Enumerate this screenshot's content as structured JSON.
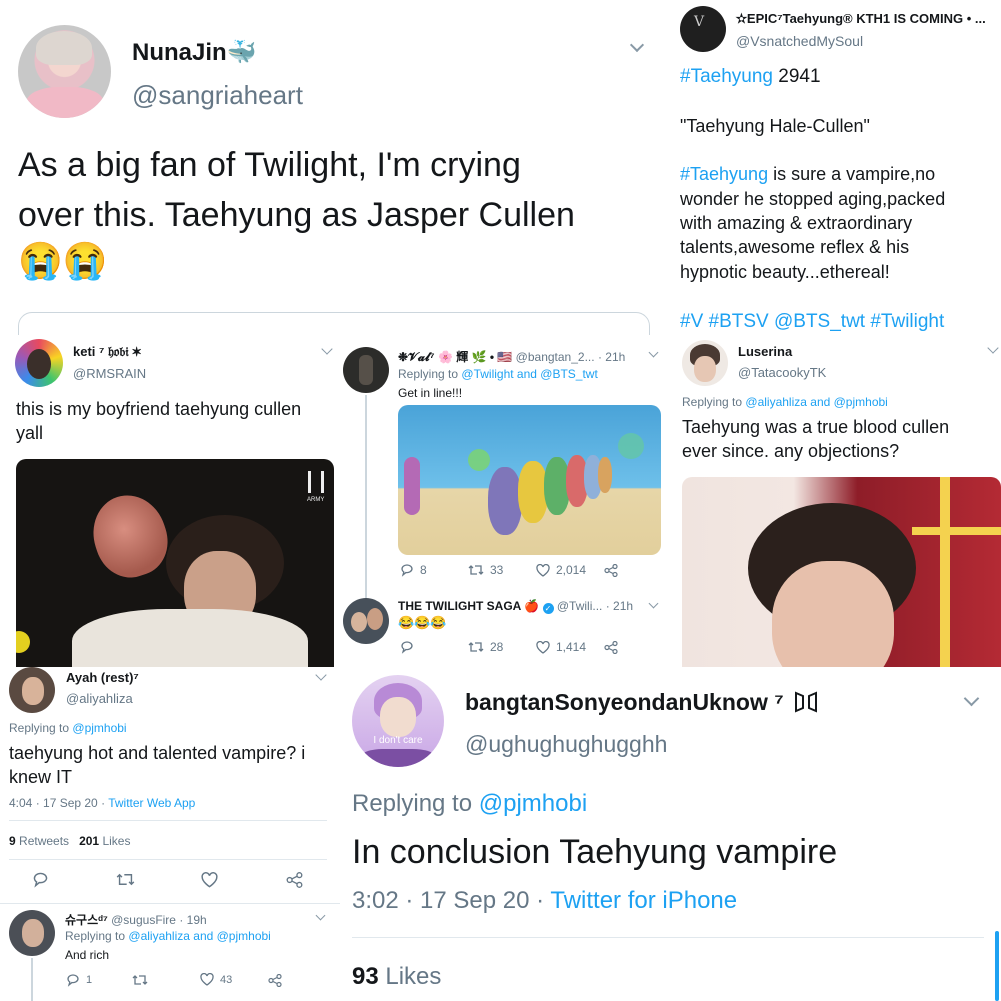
{
  "p1": {
    "name": "NunaJin",
    "emoji": "🐳",
    "handle": "@sangriaheart",
    "lines": [
      "As a big fan of Twilight, I'm crying",
      "over this. Taehyung as Jasper Cullen"
    ],
    "emojis": "😭😭"
  },
  "p2": {
    "name": "✫EPIC⁷Taehyung® KTH1 IS COMING • ...",
    "handle": "@VsnatchedMySoul",
    "line1_tag": "#Taehyung",
    "line1_rest": " 2941",
    "quote": "\"Taehyung Hale-Cullen\"",
    "body_tag": "#Taehyung",
    "body_lines": [
      " is sure a vampire,no",
      "wonder he stopped aging,packed",
      "with amazing & extraordinary",
      "talents,awesome reflex & his",
      "hypnotic beauty...ethereal!"
    ],
    "tags": "#V #BTSV @BTS_twt #Twilight"
  },
  "p3": {
    "name": "keti ⁷ 𝔥𝔬𝔟𝔦 ✶",
    "handle": "@RMSRAIN",
    "lines": [
      "this is my boyfriend taehyung cullen",
      "yall"
    ],
    "logo": "ARMY"
  },
  "p4": {
    "t1_name": "❉𝓥𝓪𝓵⁷ 🌸 輝 🌿 • 🇺🇸",
    "t1_handle": "@bangtan_2...",
    "t1_time": "· 21h",
    "t1_replying": "Replying to",
    "t1_mentions": "@Twilight and @BTS_twt",
    "t1_text": "Get in line!!!",
    "t1_retweets": "33",
    "t1_likes": "2,014",
    "t1_replies": "8",
    "t2_name": "THE TWILIGHT SAGA 🍎",
    "t2_handle": "@Twili...",
    "t2_time": "· 21h",
    "t2_text": "😂😂😂",
    "t2_retweets": "28",
    "t2_likes": "1,414"
  },
  "p5": {
    "name": "Luserina",
    "handle": "@TatacookyTK",
    "replying": "Replying to",
    "mentions": "@aliyahliza and @pjmhobi",
    "lines": [
      "Taehyung was a true blood cullen",
      "ever since. any objections?"
    ]
  },
  "p6": {
    "name": "Ayah (rest)⁷",
    "handle": "@aliyahliza",
    "replying": "Replying to",
    "mention": "@pjmhobi",
    "lines": [
      "taehyung hot and talented vampire? i",
      "knew IT"
    ],
    "time": "4:04 · 17 Sep 20 ·",
    "app": "Twitter Web App",
    "retweets": "9",
    "retweets_label": "Retweets",
    "likes": "201",
    "likes_label": "Likes",
    "r_name": "슈구스ᵈ⁷",
    "r_handle": "@sugusFire · 19h",
    "r_replying": "Replying to",
    "r_mentions": "@aliyahliza and @pjmhobi",
    "r_text": "And rich",
    "r_replies": "1",
    "r_likes": "43"
  },
  "p7": {
    "name": "bangtanSonyeondanUknow ⁷",
    "handle": "@ughughughugghh",
    "avatar_text": "I don't care",
    "replying": "Replying to",
    "mention": "@pjmhobi",
    "text": "In conclusion Taehyung vampire",
    "time": "3:02 · 17 Sep 20 ·",
    "app": "Twitter for iPhone",
    "likes": "93",
    "likes_label": "Likes"
  }
}
